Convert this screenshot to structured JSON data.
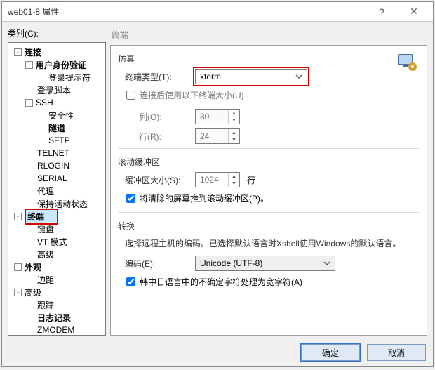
{
  "window": {
    "title": "web01-8 属性"
  },
  "left": {
    "category_label": "类别(C):",
    "tree": [
      {
        "l": 0,
        "exp": "-",
        "label": "连接",
        "bold": true
      },
      {
        "l": 1,
        "exp": "-",
        "label": "用户身份验证",
        "bold": true
      },
      {
        "l": 2,
        "label": "登录提示符"
      },
      {
        "l": 1,
        "label": "登录脚本"
      },
      {
        "l": 1,
        "exp": "-",
        "label": "SSH"
      },
      {
        "l": 2,
        "label": "安全性"
      },
      {
        "l": 2,
        "label": "隧道",
        "bold": true
      },
      {
        "l": 2,
        "label": "SFTP"
      },
      {
        "l": 1,
        "label": "TELNET"
      },
      {
        "l": 1,
        "label": "RLOGIN"
      },
      {
        "l": 1,
        "label": "SERIAL"
      },
      {
        "l": 1,
        "label": "代理"
      },
      {
        "l": 1,
        "label": "保持活动状态"
      },
      {
        "l": 0,
        "exp": "-",
        "label": "终端",
        "bold": true,
        "selected": true
      },
      {
        "l": 1,
        "label": "键盘"
      },
      {
        "l": 1,
        "label": "VT 模式"
      },
      {
        "l": 1,
        "label": "高级"
      },
      {
        "l": 0,
        "exp": "-",
        "label": "外观",
        "bold": true
      },
      {
        "l": 1,
        "label": "边距"
      },
      {
        "l": 0,
        "exp": "-",
        "label": "高级"
      },
      {
        "l": 1,
        "label": "跟踪"
      },
      {
        "l": 1,
        "label": "日志记录",
        "bold": true
      },
      {
        "l": 1,
        "label": "ZMODEM"
      }
    ]
  },
  "panel": {
    "title": "终端",
    "emulation": {
      "head": "仿真",
      "type_label": "终端类型(T):",
      "type_value": "xterm",
      "use_size_label": "连接后使用以下终端大小(U)",
      "cols_label": "列(O):",
      "cols_value": "80",
      "rows_label": "行(R):",
      "rows_value": "24"
    },
    "scroll": {
      "head": "滚动缓冲区",
      "buf_label": "缓冲区大小(S):",
      "buf_value": "1024",
      "buf_unit": "行",
      "push_label": "将清除的屏幕推到滚动缓冲区(P)。"
    },
    "convert": {
      "head": "转换",
      "desc": "选择远程主机的编码。已选择默认语言时Xshell使用Windows的默认语言。",
      "enc_label": "编码(E):",
      "enc_value": "Unicode (UTF-8)",
      "cjk_label": "韩中日语言中的不确定字符处理为宽字符(A)"
    }
  },
  "footer": {
    "ok": "确定",
    "cancel": "取消"
  }
}
